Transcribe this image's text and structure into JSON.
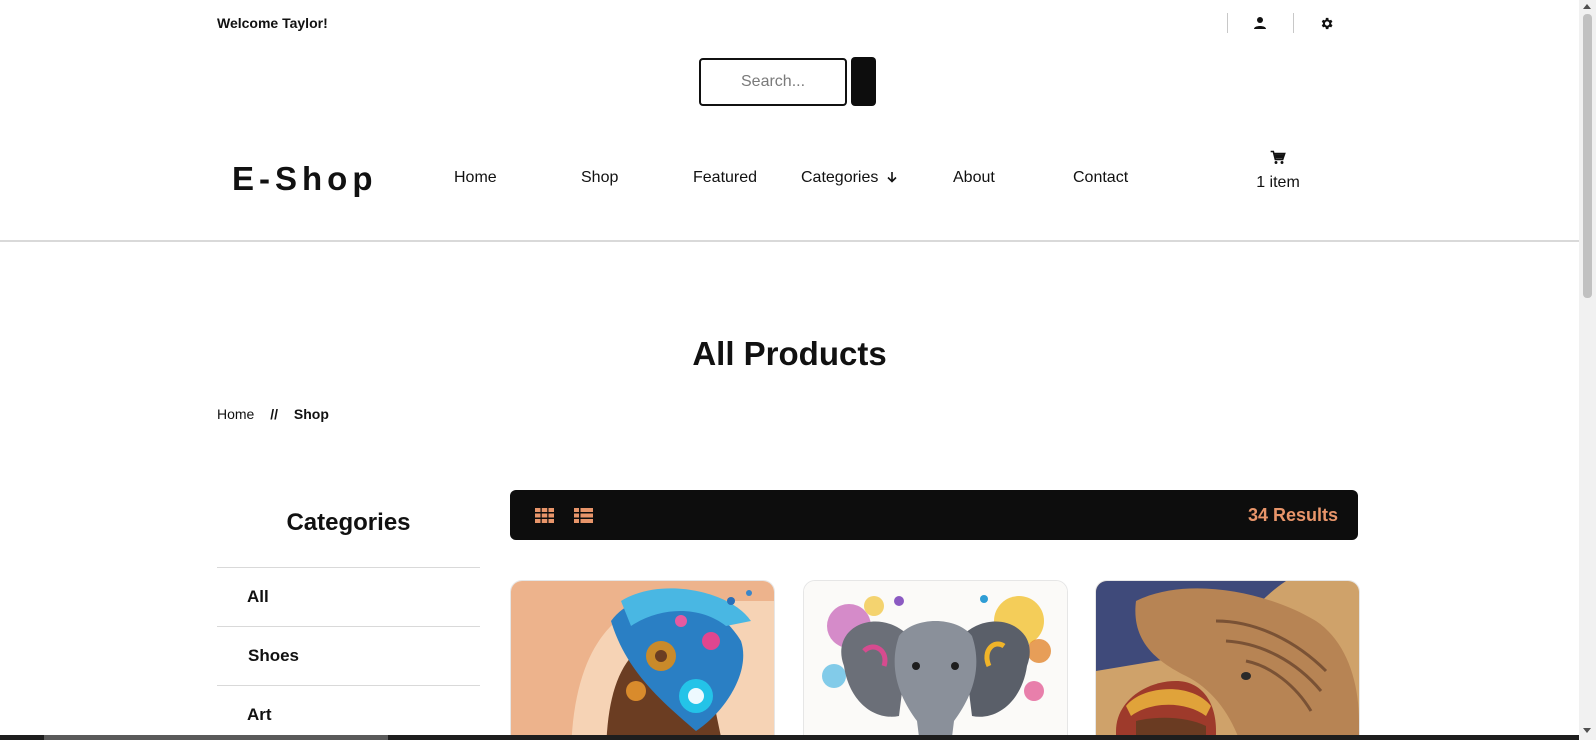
{
  "topbar": {
    "welcome": "Welcome Taylor!",
    "icons": [
      "user-icon",
      "gear-icon"
    ]
  },
  "search": {
    "placeholder": "Search...",
    "value": ""
  },
  "header": {
    "logo": "E-Shop",
    "nav": {
      "home": "Home",
      "shop": "Shop",
      "featured": "Featured",
      "categories": "Categories",
      "about": "About",
      "contact": "Contact"
    },
    "cart": {
      "icon": "cart-icon",
      "count": "1 item"
    }
  },
  "main": {
    "title": "All Products",
    "breadcrumb": {
      "home": "Home",
      "separator": "//",
      "current": "Shop"
    }
  },
  "sidebar": {
    "heading": "Categories",
    "items": [
      "All",
      "Shoes",
      "Art"
    ]
  },
  "toolbar": {
    "results": "34 Results",
    "views": [
      "grid-view-icon",
      "list-view-icon"
    ],
    "accent": "#e8956a",
    "background": "#0d0d0d"
  },
  "products": [
    {
      "image": "woman-with-colorful-gear-splash-art"
    },
    {
      "image": "colorful-paint-splash-elephant-art"
    },
    {
      "image": "elephant-and-woman-portrait-art"
    }
  ]
}
